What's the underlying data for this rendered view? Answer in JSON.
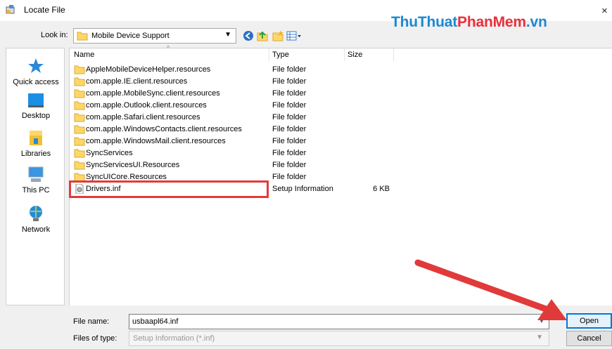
{
  "window": {
    "title": "Locate File",
    "close_glyph": "×"
  },
  "watermark": {
    "part1": "ThuThuat",
    "part2": "PhanMem",
    "part3": ".vn"
  },
  "lookin": {
    "label": "Look in:",
    "value": "Mobile Device Support"
  },
  "places": [
    {
      "label": "Quick access",
      "icon": "star-icon"
    },
    {
      "label": "Desktop",
      "icon": "desktop-icon"
    },
    {
      "label": "Libraries",
      "icon": "libraries-icon"
    },
    {
      "label": "This PC",
      "icon": "computer-icon"
    },
    {
      "label": "Network",
      "icon": "network-icon"
    }
  ],
  "columns": {
    "name": "Name",
    "type": "Type",
    "size": "Size"
  },
  "files": [
    {
      "name": "AppleMobileDeviceHelper.resources",
      "type": "File folder",
      "size": "",
      "icon": "folder-icon"
    },
    {
      "name": "com.apple.IE.client.resources",
      "type": "File folder",
      "size": "",
      "icon": "folder-icon"
    },
    {
      "name": "com.apple.MobileSync.client.resources",
      "type": "File folder",
      "size": "",
      "icon": "folder-icon"
    },
    {
      "name": "com.apple.Outlook.client.resources",
      "type": "File folder",
      "size": "",
      "icon": "folder-icon"
    },
    {
      "name": "com.apple.Safari.client.resources",
      "type": "File folder",
      "size": "",
      "icon": "folder-icon"
    },
    {
      "name": "com.apple.WindowsContacts.client.resources",
      "type": "File folder",
      "size": "",
      "icon": "folder-icon"
    },
    {
      "name": "com.apple.WindowsMail.client.resources",
      "type": "File folder",
      "size": "",
      "icon": "folder-icon"
    },
    {
      "name": "SyncServices",
      "type": "File folder",
      "size": "",
      "icon": "folder-icon"
    },
    {
      "name": "SyncServicesUI.Resources",
      "type": "File folder",
      "size": "",
      "icon": "folder-icon"
    },
    {
      "name": "SyncUICore.Resources",
      "type": "File folder",
      "size": "",
      "icon": "folder-icon"
    },
    {
      "name": "Drivers.inf",
      "type": "Setup Information",
      "size": "6 KB",
      "icon": "inf-file-icon"
    }
  ],
  "filename": {
    "label": "File name:",
    "value": "usbaapl64.inf"
  },
  "filetype": {
    "label": "Files of type:",
    "value": "Setup Information (*.inf)"
  },
  "buttons": {
    "open": "Open",
    "cancel": "Cancel"
  },
  "colors": {
    "highlight": "#e53939",
    "accent": "#0078d7",
    "folder": "#ffd766"
  }
}
